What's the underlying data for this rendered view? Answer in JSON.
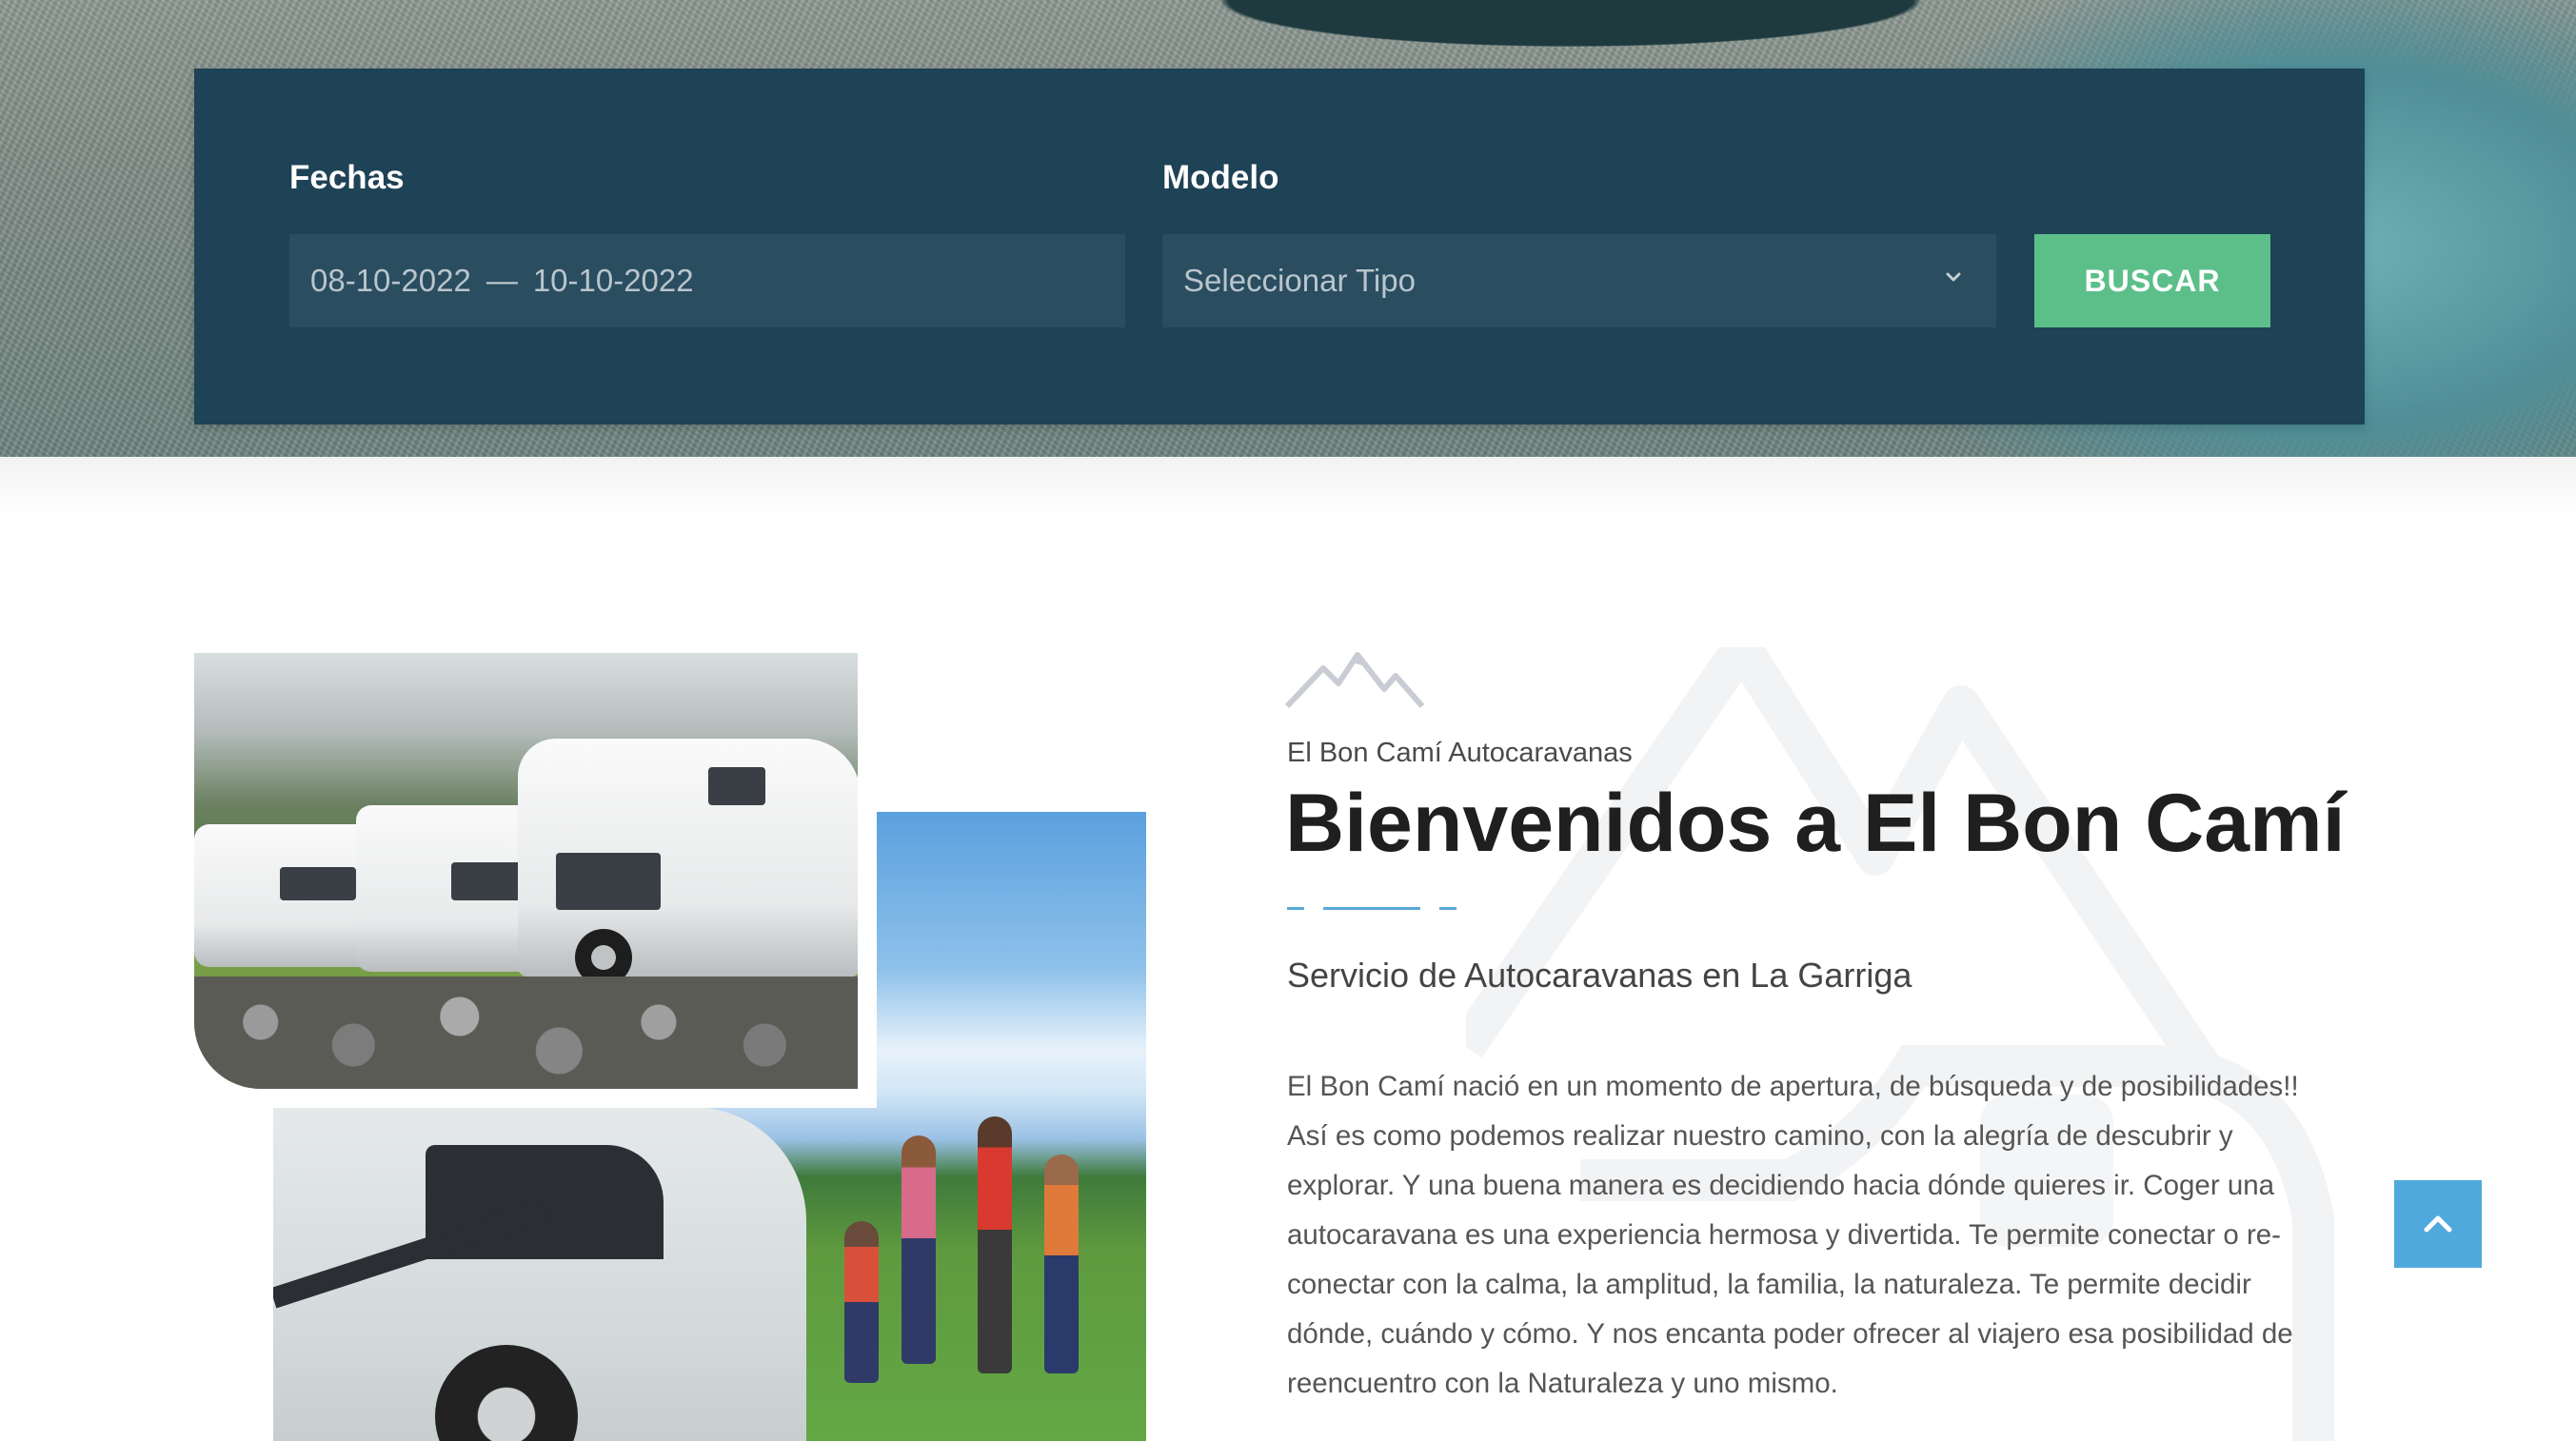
{
  "search": {
    "dates_label": "Fechas",
    "date_from": "08-10-2022",
    "date_separator": "—",
    "date_to": "10-10-2022",
    "model_label": "Modelo",
    "model_placeholder": "Seleccionar Tipo",
    "button_label": "BUSCAR"
  },
  "about": {
    "eyebrow": "El Bon Camí Autocaravanas",
    "title": "Bienvenidos a El Bon Camí",
    "subtitle": "Servicio de Autocaravanas en La Garriga",
    "body": "El Bon Camí nació en un momento de apertura, de búsqueda y de posibilidades!! Así es como podemos realizar nuestro camino, con la alegría de descubrir y explorar. Y una buena manera es decidiendo hacia dónde quieres ir. Coger una autocaravana es una experiencia hermosa y divertida. Te permite conectar o re-conectar con la calma, la amplitud, la familia, la naturaleza. Te permite decidir dónde, cuándo y cómo. Y nos encanta poder ofrecer al viajero esa posibilidad de reencuentro con la Naturaleza y uno mismo."
  },
  "colors": {
    "panel": "#1e4256",
    "field": "#2a4d60",
    "button": "#5cbf8a",
    "accent": "#4fa9dd"
  },
  "icons": [
    "chevron-down-icon",
    "mountain-icon",
    "chevron-up-icon"
  ]
}
